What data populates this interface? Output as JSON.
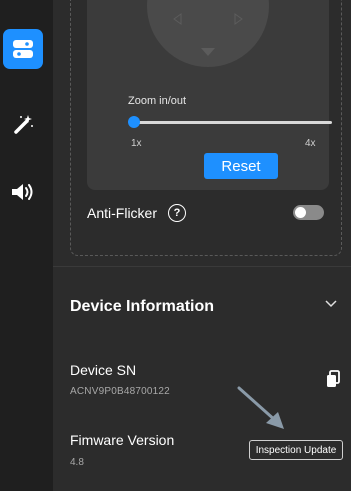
{
  "sidebar": {
    "items": [
      {
        "icon": "settings-panel-icon",
        "active": true
      },
      {
        "icon": "magic-wand-icon",
        "active": false
      },
      {
        "icon": "speaker-icon",
        "active": false
      }
    ]
  },
  "camera_control": {
    "zoom_label": "Zoom in/out",
    "zoom_min_label": "1x",
    "zoom_max_label": "4x",
    "zoom_value": 1,
    "reset_label": "Reset"
  },
  "anti_flicker": {
    "label": "Anti-Flicker",
    "help_icon": "help-icon",
    "enabled": false
  },
  "device_info": {
    "title": "Device Information",
    "sn_label": "Device SN",
    "sn_value": "ACNV9P0B48700122",
    "firmware_label": "Fimware Version",
    "firmware_value": "4.8",
    "update_button_label": "Inspection Update"
  },
  "colors": {
    "accent": "#1e90ff",
    "background": "#2c2c2c",
    "sidebar": "#1f1f1f",
    "card": "#3b3b3b"
  }
}
